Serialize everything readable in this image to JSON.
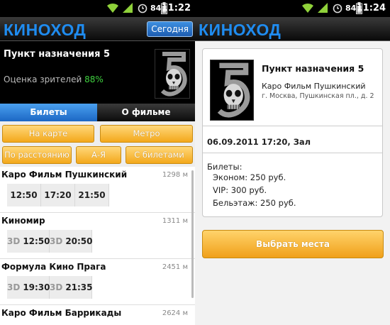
{
  "left": {
    "status": {
      "battery_pct": "84",
      "time": "11:22"
    },
    "logo": "КИНОХОД",
    "today_button": "Сегодня",
    "movie": {
      "title": "Пункт назначения 5",
      "rating_label": "Оценка зрителей",
      "rating_value": "88%"
    },
    "tabs": {
      "tickets": "Билеты",
      "about": "О фильме"
    },
    "filters": {
      "on_map": "На карте",
      "metro": "Метро",
      "by_distance": "По расстоянию",
      "az": "А-Я",
      "with_tickets": "С билетами"
    },
    "cinemas": [
      {
        "name": "Каро Фильм Пушкинский",
        "distance": "1298 м",
        "showtimes": [
          {
            "format": "",
            "time": "12:50"
          },
          {
            "format": "",
            "time": "17:20"
          },
          {
            "format": "",
            "time": "21:50"
          }
        ]
      },
      {
        "name": "Киномир",
        "distance": "1311 м",
        "showtimes": [
          {
            "format": "3D",
            "time": "12:50"
          },
          {
            "format": "3D",
            "time": "20:50"
          }
        ]
      },
      {
        "name": "Формула Кино Прага",
        "distance": "2451 м",
        "showtimes": [
          {
            "format": "3D",
            "time": "19:30"
          },
          {
            "format": "3D",
            "time": "21:35"
          }
        ]
      },
      {
        "name": "Каро Фильм Баррикады",
        "distance": "2624 м",
        "showtimes": []
      }
    ]
  },
  "right": {
    "status": {
      "battery_pct": "84",
      "time": "11:24"
    },
    "logo": "КИНОХОД",
    "movie_title": "Пункт назначения 5",
    "cinema_name": "Каро Фильм Пушкинский",
    "address": "г. Москва, Пушкинская пл., д. 2",
    "session": "06.09.2011 17:20, Зал",
    "tickets_label": "Билеты:",
    "prices": [
      "Эконом: 250 руб.",
      "VIP: 300 руб.",
      "Бельэтаж: 250 руб."
    ],
    "choose_button": "Выбрать места"
  },
  "colors": {
    "accent_blue": "#1f8cf0",
    "orange": "#f3a81b",
    "rating_green": "#3fd03f"
  }
}
